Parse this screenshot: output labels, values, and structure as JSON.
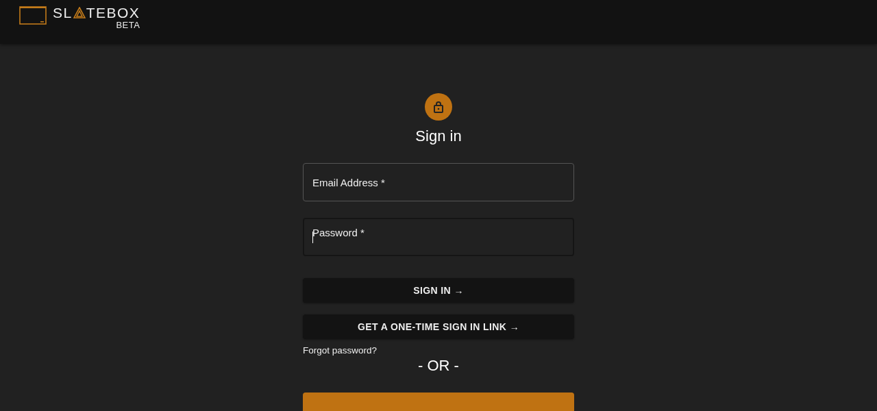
{
  "header": {
    "logo_left": "SL",
    "logo_right": "TEBOX",
    "badge": "BETA"
  },
  "title": "Sign in",
  "fields": [
    {
      "placeholder": "Email Address *",
      "focused": false
    },
    {
      "placeholder": "Password *",
      "focused": true
    }
  ],
  "buttons": [
    {
      "label": "SIGN IN →",
      "kind": "dark"
    },
    {
      "label": "GET A ONE-TIME SIGN IN LINK →",
      "kind": "dark"
    }
  ],
  "forgot_link": "Forgot password?",
  "divider": "- OR -",
  "bottom_buttons": [
    {
      "kind": "accent"
    }
  ]
}
